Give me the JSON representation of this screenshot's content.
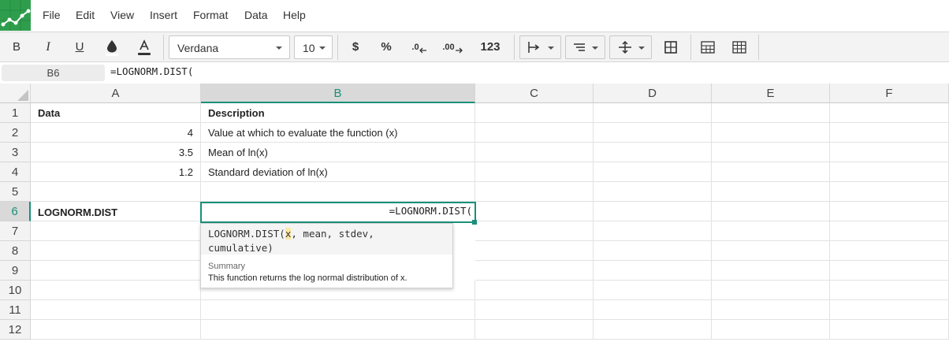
{
  "menu": {
    "items": [
      "File",
      "Edit",
      "View",
      "Insert",
      "Format",
      "Data",
      "Help"
    ]
  },
  "toolbar": {
    "bold": "B",
    "italic": "I",
    "underline": "U",
    "font_family": "Verdana",
    "font_size": "10",
    "currency": "$",
    "percent": "%",
    "decrease_decimals": ".0",
    "increase_decimals": ".00",
    "number_format": "123"
  },
  "formula_bar": {
    "cell_ref": "B6",
    "formula": "=LOGNORM.DIST("
  },
  "grid": {
    "columns": [
      "A",
      "B",
      "C",
      "D",
      "E",
      "F"
    ],
    "active_column": "B",
    "rows": [
      "1",
      "2",
      "3",
      "4",
      "5",
      "6",
      "7",
      "8",
      "9",
      "10",
      "11",
      "12"
    ],
    "active_row": "6",
    "cells": {
      "A1": "Data",
      "B1": "Description",
      "A2": "4",
      "B2": "Value at which to evaluate the function (x)",
      "A3": "3.5",
      "B3": "Mean of ln(x)",
      "A4": "1.2",
      "B4": "Standard deviation of ln(x)",
      "A6": "LOGNORM.DIST",
      "B6": "=LOGNORM.DIST("
    }
  },
  "autocomplete": {
    "fn_name": "LOGNORM.DIST(",
    "arg_active": "x",
    "args_rest": ", mean, stdev,",
    "args_line2": "cumulative)",
    "summary_label": "Summary",
    "summary_text": "This function returns the log normal distribution of x."
  },
  "colors": {
    "accent": "#1a8f7a",
    "logo": "#2e9e4d",
    "highlight": "#fde8a6"
  }
}
